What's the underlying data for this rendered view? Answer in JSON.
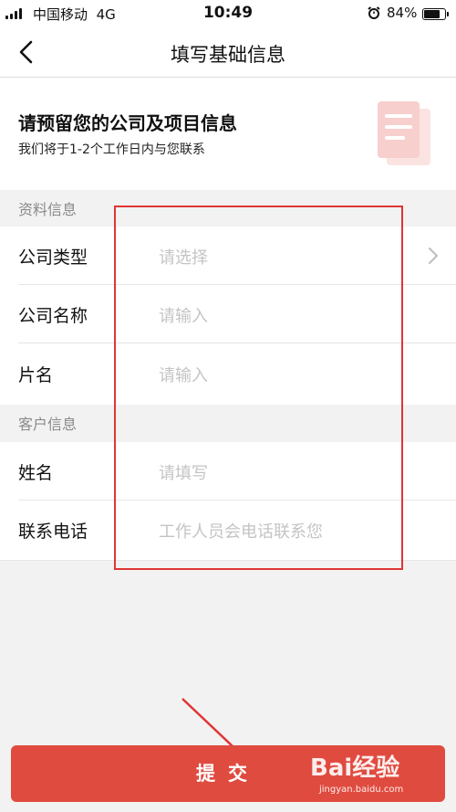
{
  "status_bar": {
    "carrier": "中国移动",
    "network": "4G",
    "time": "10:49",
    "battery": "84%",
    "battery_level": 0.84
  },
  "nav": {
    "title": "填写基础信息",
    "back_icon": "chevron-left-icon"
  },
  "intro": {
    "title": "请预留您的公司及项目信息",
    "subtitle": "我们将于1-2个工作日内与您联系",
    "graphic_icon": "document-icon"
  },
  "sections": [
    {
      "header": "资料信息",
      "rows": [
        {
          "label": "公司类型",
          "placeholder": "请选择",
          "has_chevron": true
        },
        {
          "label": "公司名称",
          "placeholder": "请输入"
        },
        {
          "label": "片名",
          "placeholder": "请输入"
        }
      ]
    },
    {
      "header": "客户信息",
      "rows": [
        {
          "label": "姓名",
          "placeholder": "请填写"
        },
        {
          "label": "联系电话",
          "placeholder": "工作人员会电话联系您"
        }
      ]
    }
  ],
  "submit": {
    "label": "提交"
  },
  "watermark": {
    "text": "Bai经验",
    "url": "jingyan.baidu.com"
  },
  "colors": {
    "accent": "#e04b3f",
    "annotation": "#e03535",
    "placeholder": "#c4c4c4",
    "section_bg": "#f2f2f2"
  }
}
